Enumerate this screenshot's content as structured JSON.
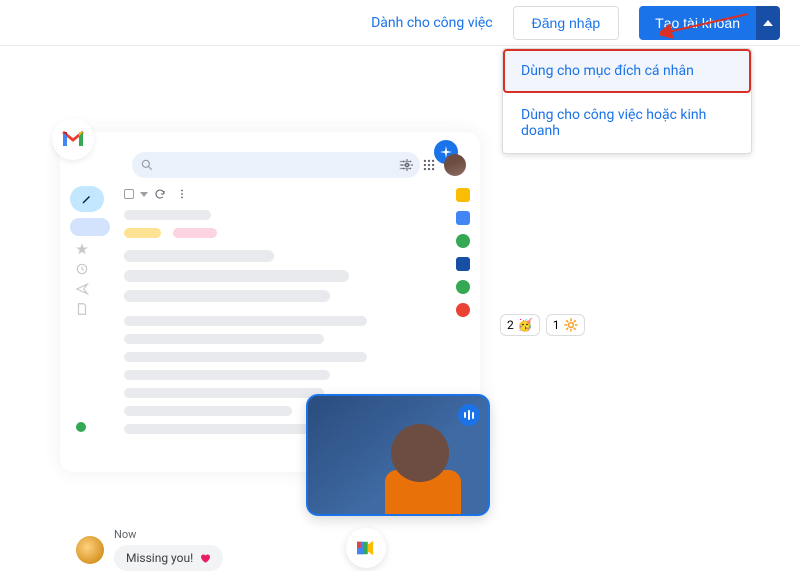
{
  "topbar": {
    "work_link": "Dành cho công việc",
    "login_label": "Đăng nhập",
    "create_label": "Tạo tài khoản"
  },
  "dropdown": {
    "personal": "Dùng cho mục đích cá nhân",
    "business": "Dùng cho công việc hoặc kinh doanh"
  },
  "reactions": {
    "r1_count": "2",
    "r2_count": "1"
  },
  "chat": {
    "time": "Now",
    "text": "Missing you!"
  }
}
